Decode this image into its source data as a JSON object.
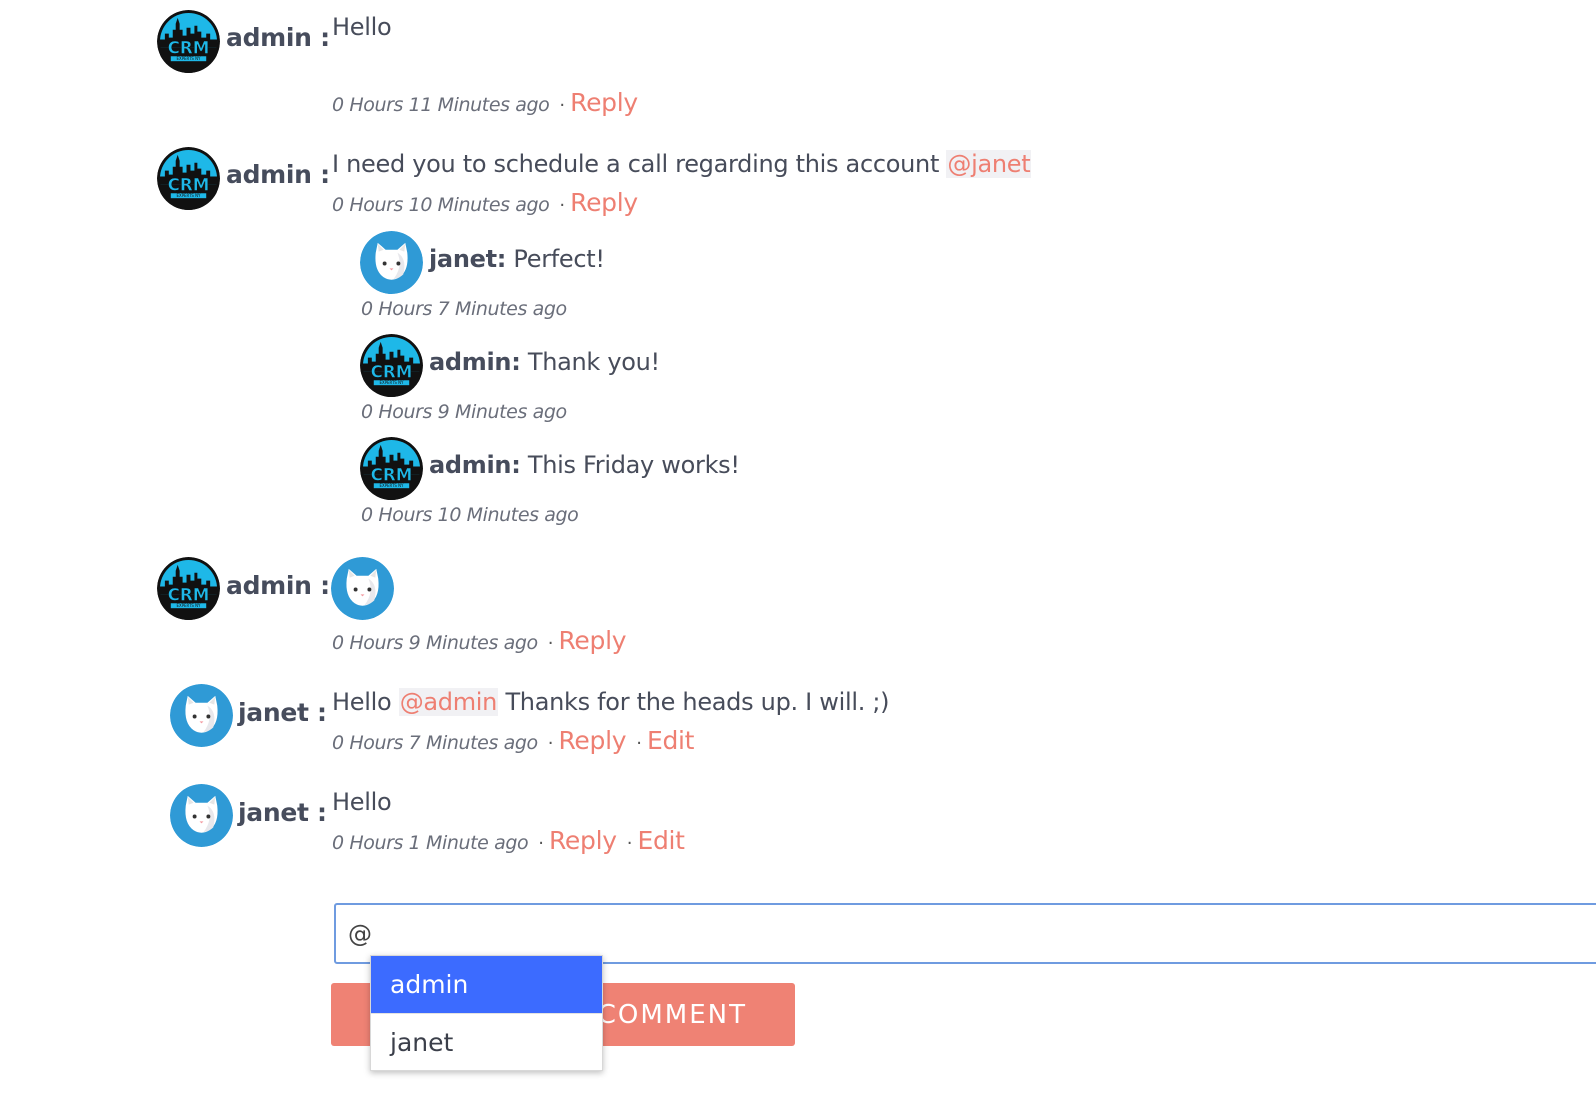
{
  "comments": [
    {
      "author": "admin :",
      "avatar": "crm-logo",
      "text": "Hello",
      "time": "0 Hours 11 Minutes ago",
      "reply_label": "Reply"
    },
    {
      "author": "admin :",
      "avatar": "crm-logo",
      "text": "I need you to schedule a call regarding this account",
      "mention": "@janet",
      "time": "0 Hours 10 Minutes ago",
      "reply_label": "Reply",
      "replies": [
        {
          "author": "janet:",
          "avatar": "cat",
          "text": "Perfect!",
          "time": "0 Hours 7 Minutes ago"
        },
        {
          "author": "admin:",
          "avatar": "crm-logo",
          "text": "Thank you!",
          "time": "0 Hours 9 Minutes ago"
        },
        {
          "author": "admin:",
          "avatar": "crm-logo",
          "text": "This Friday works!",
          "time": "0 Hours 10 Minutes ago"
        }
      ]
    },
    {
      "author": "admin :",
      "avatar": "crm-logo",
      "attachment": "cat-avatar-image",
      "time": "0 Hours 9 Minutes ago",
      "reply_label": "Reply"
    },
    {
      "author": "janet :",
      "avatar": "cat",
      "text_before": "Hello",
      "mention": "@admin",
      "text_after": "Thanks for the heads up. I will. ;)",
      "time": "0 Hours 7 Minutes ago",
      "reply_label": "Reply",
      "edit_label": "Edit"
    },
    {
      "author": "janet :",
      "avatar": "cat",
      "text": "Hello",
      "time": "0 Hours 1 Minute ago",
      "reply_label": "Reply",
      "edit_label": "Edit"
    }
  ],
  "composer": {
    "value": "@",
    "button_label": "COMMENT",
    "suggestions": [
      "admin",
      "janet"
    ],
    "selected_suggestion": "admin"
  },
  "colors": {
    "accent": "#ee7f72",
    "button": "#ef8274",
    "selected": "#3c6bff",
    "input_border": "#6f9be0"
  },
  "separator": "·"
}
